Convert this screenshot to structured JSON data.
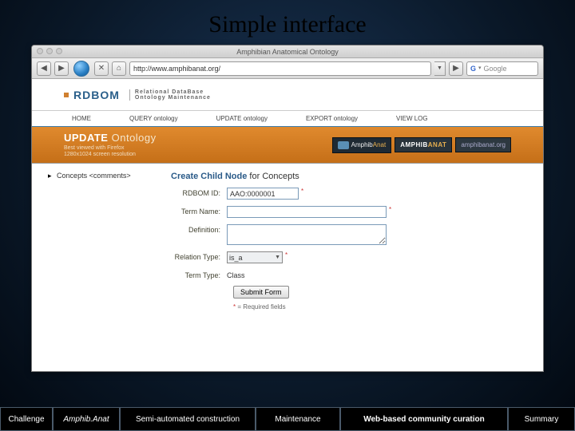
{
  "slide": {
    "title": "Simple interface"
  },
  "browser": {
    "window_title": "Amphibian Anatomical Ontology",
    "url": "http://www.amphibanat.org/",
    "search_placeholder": "Google"
  },
  "site": {
    "logo": "RDBOM",
    "logo_sub_line1": "Relational DataBase",
    "logo_sub_line2": "Ontology Maintenance",
    "nav": [
      "HOME",
      "QUERY ontology",
      "UPDATE ontology",
      "EXPORT ontology",
      "VIEW LOG"
    ],
    "banner_title_bold": "UPDATE",
    "banner_title_light": "Ontology",
    "banner_hint_line1": "Best viewed with Firefox",
    "banner_hint_line2": "1280x1024 screen resolution",
    "amphib_badge": "AmphibAnat",
    "amphib_badge_prefix": "Amphib",
    "amphib_badge_suffix": "Anat",
    "amphib_logo_word1": "AMPHIB",
    "amphib_logo_word2": "ANAT",
    "amphib_url": "amphibanat.org"
  },
  "leftcol": {
    "item": "Concepts <comments>"
  },
  "form": {
    "header_strong": "Create Child Node",
    "header_rest": "for Concepts",
    "labels": {
      "rdbom_id": "RDBOM ID:",
      "term_name": "Term Name:",
      "definition": "Definition:",
      "relation_type": "Relation Type:",
      "term_type": "Term Type:"
    },
    "values": {
      "rdbom_id": "AAO:0000001",
      "term_name": "",
      "definition": "",
      "relation_type": "is_a",
      "term_type": "Class"
    },
    "submit_label": "Submit Form",
    "required_note": "= Required fields",
    "required_mark": "*"
  },
  "slidenav": {
    "items": [
      "Challenge",
      "Amphib.Anat",
      "Semi-automated construction",
      "Maintenance",
      "Web-based community curation",
      "Summary"
    ]
  }
}
